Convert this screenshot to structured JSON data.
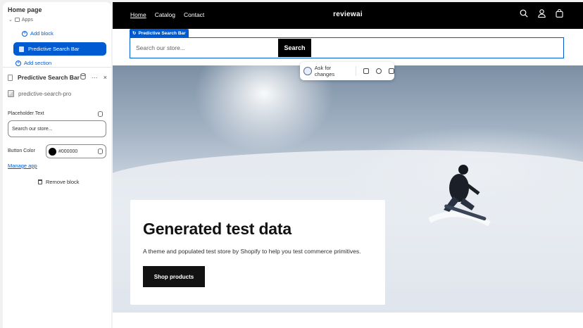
{
  "editor": {
    "tree": {
      "title": "Home page",
      "apps_label": "Apps",
      "add_block": "Add block",
      "selected_block": "Predictive Search Bar",
      "add_section": "Add section"
    },
    "panel": {
      "title": "Predictive Search Bar",
      "more": "···",
      "close": "×",
      "app_name": "predictive-search-pro",
      "placeholder_label": "Placeholder Text",
      "placeholder_value": "Search our store...",
      "button_color_label": "Button Color",
      "button_color_value": "#000000",
      "manage_app": "Manage app",
      "remove_block": "Remove block"
    }
  },
  "store": {
    "nav": {
      "links": [
        "Home",
        "Catalog",
        "Contact"
      ],
      "brand": "reviewai"
    },
    "search": {
      "block_tag": "Predictive Search Bar",
      "placeholder": "Search our store...",
      "button": "Search"
    },
    "ai_bar": {
      "label": "Ask for changes"
    },
    "hero": {
      "title": "Generated test data",
      "subtitle": "A theme and populated test store by Shopify to help you test commerce primitives.",
      "button": "Shop products"
    }
  },
  "colors": {
    "accent": "#005bd3",
    "nav_bg": "#000000",
    "button_color": "#000000"
  },
  "icons": [
    "search-icon",
    "account-icon",
    "cart-icon",
    "database-icon",
    "trash-icon",
    "copy-icon",
    "hide-icon"
  ]
}
